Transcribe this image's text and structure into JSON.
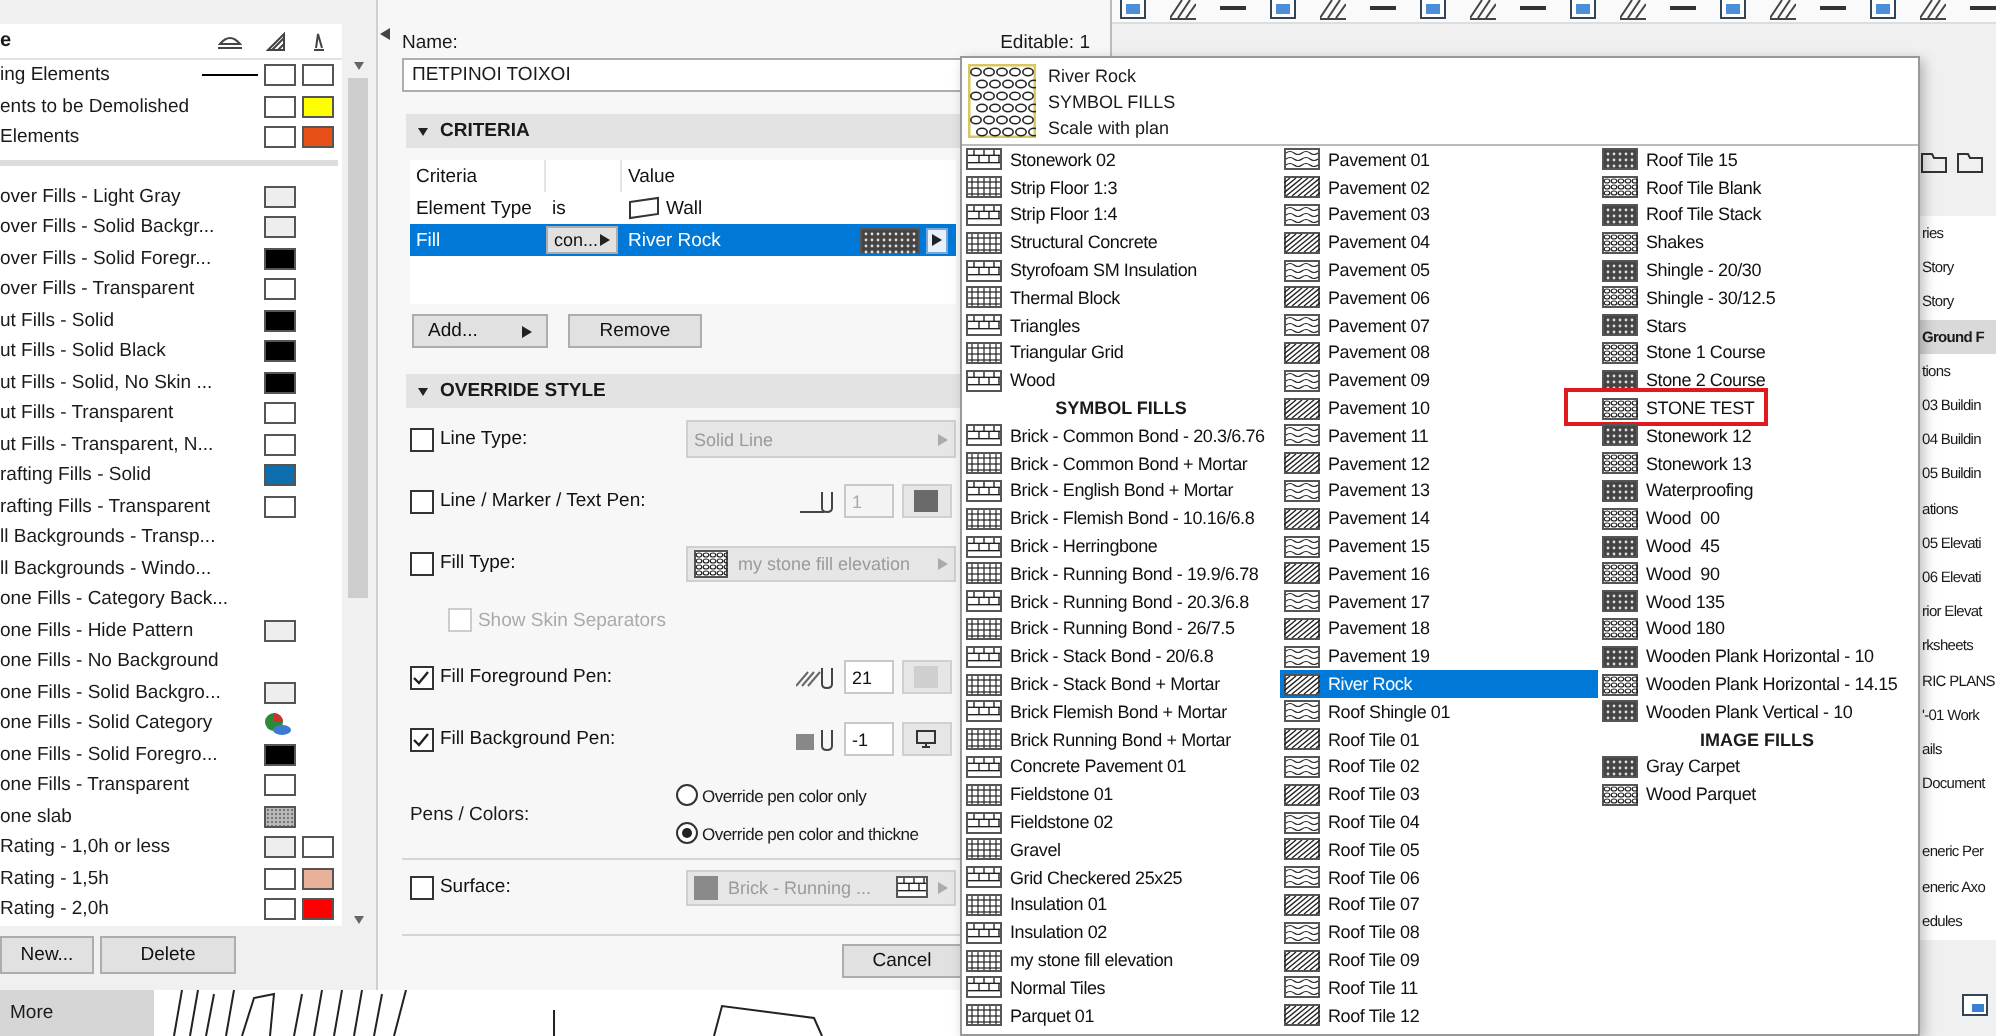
{
  "left_panel": {
    "heading": "e",
    "top_rows": [
      {
        "label": "ing Elements",
        "swatches": [
          {
            "kind": "line"
          },
          {
            "kind": "color",
            "color": "#ffffff"
          },
          {
            "kind": "color",
            "color": "#ffffff"
          }
        ]
      },
      {
        "label": "ents to be Demolished",
        "swatches": [
          {
            "kind": "color",
            "color": "#ffffff"
          },
          {
            "kind": "color",
            "color": "#ffff00"
          }
        ]
      },
      {
        "label": "Elements",
        "swatches": [
          {
            "kind": "color",
            "color": "#ffffff"
          },
          {
            "kind": "color",
            "color": "#e8501a"
          }
        ]
      }
    ],
    "rows": [
      {
        "label": "over Fills - Light Gray",
        "swatches": [
          {
            "kind": "color",
            "color": "#eeeeee"
          }
        ]
      },
      {
        "label": "over Fills - Solid Backgr...",
        "swatches": [
          {
            "kind": "color",
            "color": "#eeeeee"
          }
        ]
      },
      {
        "label": "over Fills - Solid Foregr...",
        "swatches": [
          {
            "kind": "color",
            "color": "#000000"
          }
        ]
      },
      {
        "label": "over Fills - Transparent",
        "swatches": [
          {
            "kind": "color",
            "color": "#ffffff"
          }
        ]
      },
      {
        "label": "ut Fills - Solid",
        "swatches": [
          {
            "kind": "color",
            "color": "#000000"
          }
        ]
      },
      {
        "label": "ut Fills - Solid Black",
        "swatches": [
          {
            "kind": "color",
            "color": "#000000"
          }
        ]
      },
      {
        "label": "ut Fills - Solid, No Skin ...",
        "swatches": [
          {
            "kind": "color",
            "color": "#000000"
          }
        ]
      },
      {
        "label": "ut Fills - Transparent",
        "swatches": [
          {
            "kind": "color",
            "color": "#ffffff"
          }
        ]
      },
      {
        "label": "ut Fills - Transparent, N...",
        "swatches": [
          {
            "kind": "color",
            "color": "#ffffff"
          }
        ]
      },
      {
        "label": "rafting Fills - Solid",
        "swatches": [
          {
            "kind": "color",
            "color": "#0d6fae"
          }
        ]
      },
      {
        "label": "rafting Fills - Transparent",
        "swatches": [
          {
            "kind": "color",
            "color": "#ffffff"
          }
        ]
      },
      {
        "label": "ll Backgrounds - Transp..."
      },
      {
        "label": "ll Backgrounds - Windo..."
      },
      {
        "label": "one Fills - Category Back..."
      },
      {
        "label": "one Fills - Hide Pattern",
        "swatches": [
          {
            "kind": "color",
            "color": "#eeeeee"
          }
        ]
      },
      {
        "label": "one Fills - No Background"
      },
      {
        "label": "one Fills - Solid Backgro...",
        "swatches": [
          {
            "kind": "color",
            "color": "#eeeeee"
          }
        ]
      },
      {
        "label": "one Fills - Solid Category",
        "swatches": [
          {
            "kind": "category"
          }
        ]
      },
      {
        "label": "one Fills - Solid Foregro...",
        "swatches": [
          {
            "kind": "color",
            "color": "#000000"
          }
        ]
      },
      {
        "label": "one Fills - Transparent",
        "swatches": [
          {
            "kind": "color",
            "color": "#ffffff"
          }
        ]
      },
      {
        "label": "one slab",
        "swatches": [
          {
            "kind": "pattern"
          }
        ]
      },
      {
        "label": "Rating - 1,0h or less",
        "swatches": [
          {
            "kind": "color",
            "color": "#eeeeee"
          },
          {
            "kind": "color",
            "color": "#ffffff"
          }
        ]
      },
      {
        "label": "Rating - 1,5h",
        "swatches": [
          {
            "kind": "color",
            "color": "#ffffff"
          },
          {
            "kind": "color",
            "color": "#e9b09a"
          }
        ]
      },
      {
        "label": "Rating - 2,0h",
        "swatches": [
          {
            "kind": "color",
            "color": "#ffffff"
          },
          {
            "kind": "color",
            "color": "#ff0000"
          }
        ]
      }
    ],
    "buttons": [
      "New...",
      "Delete"
    ],
    "more_tab": "More"
  },
  "rule_dialog": {
    "name_label": "Name:",
    "name_value": "ΠΕΤΡΙΝΟΙ ΤΟΙΧΟΙ",
    "editable": "Editable: 1",
    "criteria": {
      "title": "CRITERIA",
      "expanded": true,
      "criteria_heading": "Criteria",
      "value_heading": "Value",
      "rows": [
        {
          "kind": "element-type",
          "criteria": "Element Type",
          "operator": "is",
          "value": "Wall",
          "selected": false
        },
        {
          "kind": "fill",
          "criteria": "Fill",
          "operator": "con...",
          "value": "River Rock",
          "selected": true
        }
      ],
      "add_button": "Add...",
      "remove_button": "Remove"
    },
    "override": {
      "title": "OVERRIDE STYLE",
      "expanded": true,
      "options": [
        {
          "kind": "dropdown",
          "label": "Line Type:",
          "checked": false,
          "value": "Solid Line"
        },
        {
          "kind": "line-pen",
          "label": "Line / Marker / Text Pen:",
          "checked": false,
          "value": "1"
        },
        {
          "kind": "fill-dropdown",
          "label": "Fill Type:",
          "checked": false,
          "value": "my stone fill elevation"
        },
        {
          "kind": "sub-check",
          "label": "Show Skin Separators",
          "checked": false,
          "disabled": true
        },
        {
          "kind": "fg-pen",
          "label": "Fill Foreground Pen:",
          "checked": true,
          "value": "21"
        },
        {
          "kind": "bg-pen",
          "label": "Fill Background Pen:",
          "checked": true,
          "value": "-1"
        }
      ],
      "pens_colors": {
        "label": "Pens / Colors:",
        "choices": [
          {
            "label": "Override pen color only",
            "selected": false
          },
          {
            "label": "Override pen color and thickne",
            "selected": true
          }
        ]
      },
      "surface": {
        "label": "Surface:",
        "checked": false,
        "value": "Brick - Running ..."
      }
    },
    "cancel": "Cancel"
  },
  "fill_list": {
    "preview": {
      "name": "River Rock",
      "group": "SYMBOL FILLS",
      "scale": "Scale with plan"
    },
    "columns": [
      {
        "items": [
          {
            "kind": "fill",
            "label": "Stonework 02",
            "selected": false,
            "annotated": false
          },
          {
            "kind": "fill",
            "label": "Strip Floor 1:3",
            "selected": false,
            "annotated": false
          },
          {
            "kind": "fill",
            "label": "Strip Floor 1:4",
            "selected": false,
            "annotated": false
          },
          {
            "kind": "fill",
            "label": "Structural Concrete",
            "selected": false,
            "annotated": false
          },
          {
            "kind": "fill",
            "label": "Styrofoam SM Insulation",
            "selected": false,
            "annotated": false
          },
          {
            "kind": "fill",
            "label": "Thermal Block",
            "selected": false,
            "annotated": false
          },
          {
            "kind": "fill",
            "label": "Triangles",
            "selected": false,
            "annotated": false
          },
          {
            "kind": "fill",
            "label": "Triangular Grid",
            "selected": false,
            "annotated": false
          },
          {
            "kind": "fill",
            "label": "Wood",
            "selected": false,
            "annotated": false
          },
          {
            "kind": "group",
            "label": "SYMBOL FILLS"
          },
          {
            "kind": "fill",
            "label": "Brick - Common Bond - 20.3/6.76",
            "selected": false,
            "annotated": false
          },
          {
            "kind": "fill",
            "label": "Brick - Common Bond + Mortar",
            "selected": false,
            "annotated": false
          },
          {
            "kind": "fill",
            "label": "Brick - English Bond + Mortar",
            "selected": false,
            "annotated": false
          },
          {
            "kind": "fill",
            "label": "Brick - Flemish Bond - 10.16/6.8",
            "selected": false,
            "annotated": false
          },
          {
            "kind": "fill",
            "label": "Brick - Herringbone",
            "selected": false,
            "annotated": false
          },
          {
            "kind": "fill",
            "label": "Brick - Running Bond - 19.9/6.78",
            "selected": false,
            "annotated": false
          },
          {
            "kind": "fill",
            "label": "Brick - Running Bond - 20.3/6.8",
            "selected": false,
            "annotated": false
          },
          {
            "kind": "fill",
            "label": "Brick - Running Bond - 26/7.5",
            "selected": false,
            "annotated": false
          },
          {
            "kind": "fill",
            "label": "Brick - Stack Bond - 20/6.8",
            "selected": false,
            "annotated": false
          },
          {
            "kind": "fill",
            "label": "Brick - Stack Bond + Mortar",
            "selected": false,
            "annotated": false
          },
          {
            "kind": "fill",
            "label": "Brick Flemish Bond + Mortar",
            "selected": false,
            "annotated": false
          },
          {
            "kind": "fill",
            "label": "Brick Running Bond + Mortar",
            "selected": false,
            "annotated": false
          },
          {
            "kind": "fill",
            "label": "Concrete Pavement 01",
            "selected": false,
            "annotated": false
          },
          {
            "kind": "fill",
            "label": "Fieldstone 01",
            "selected": false,
            "annotated": false
          },
          {
            "kind": "fill",
            "label": "Fieldstone 02",
            "selected": false,
            "annotated": false
          },
          {
            "kind": "fill",
            "label": "Gravel",
            "selected": false,
            "annotated": false
          },
          {
            "kind": "fill",
            "label": "Grid Checkered 25x25",
            "selected": false,
            "annotated": false
          },
          {
            "kind": "fill",
            "label": "Insulation 01",
            "selected": false,
            "annotated": false
          },
          {
            "kind": "fill",
            "label": "Insulation 02",
            "selected": false,
            "annotated": false
          },
          {
            "kind": "fill",
            "label": "my stone fill elevation",
            "selected": false,
            "annotated": false
          },
          {
            "kind": "fill",
            "label": "Normal Tiles",
            "selected": false,
            "annotated": false
          },
          {
            "kind": "fill",
            "label": "Parquet 01",
            "selected": false,
            "annotated": false
          }
        ]
      },
      {
        "items": [
          {
            "kind": "fill",
            "label": "Pavement 01",
            "selected": false,
            "annotated": false
          },
          {
            "kind": "fill",
            "label": "Pavement 02",
            "selected": false,
            "annotated": false
          },
          {
            "kind": "fill",
            "label": "Pavement 03",
            "selected": false,
            "annotated": false
          },
          {
            "kind": "fill",
            "label": "Pavement 04",
            "selected": false,
            "annotated": false
          },
          {
            "kind": "fill",
            "label": "Pavement 05",
            "selected": false,
            "annotated": false
          },
          {
            "kind": "fill",
            "label": "Pavement 06",
            "selected": false,
            "annotated": false
          },
          {
            "kind": "fill",
            "label": "Pavement 07",
            "selected": false,
            "annotated": false
          },
          {
            "kind": "fill",
            "label": "Pavement 08",
            "selected": false,
            "annotated": false
          },
          {
            "kind": "fill",
            "label": "Pavement 09",
            "selected": false,
            "annotated": false
          },
          {
            "kind": "fill",
            "label": "Pavement 10",
            "selected": false,
            "annotated": false
          },
          {
            "kind": "fill",
            "label": "Pavement 11",
            "selected": false,
            "annotated": false
          },
          {
            "kind": "fill",
            "label": "Pavement 12",
            "selected": false,
            "annotated": false
          },
          {
            "kind": "fill",
            "label": "Pavement 13",
            "selected": false,
            "annotated": false
          },
          {
            "kind": "fill",
            "label": "Pavement 14",
            "selected": false,
            "annotated": false
          },
          {
            "kind": "fill",
            "label": "Pavement 15",
            "selected": false,
            "annotated": false
          },
          {
            "kind": "fill",
            "label": "Pavement 16",
            "selected": false,
            "annotated": false
          },
          {
            "kind": "fill",
            "label": "Pavement 17",
            "selected": false,
            "annotated": false
          },
          {
            "kind": "fill",
            "label": "Pavement 18",
            "selected": false,
            "annotated": false
          },
          {
            "kind": "fill",
            "label": "Pavement 19",
            "selected": false,
            "annotated": false
          },
          {
            "kind": "fill",
            "label": "River Rock",
            "selected": true,
            "annotated": false
          },
          {
            "kind": "fill",
            "label": "Roof Shingle 01",
            "selected": false,
            "annotated": false
          },
          {
            "kind": "fill",
            "label": "Roof Tile 01",
            "selected": false,
            "annotated": false
          },
          {
            "kind": "fill",
            "label": "Roof Tile 02",
            "selected": false,
            "annotated": false
          },
          {
            "kind": "fill",
            "label": "Roof Tile 03",
            "selected": false,
            "annotated": false
          },
          {
            "kind": "fill",
            "label": "Roof Tile 04",
            "selected": false,
            "annotated": false
          },
          {
            "kind": "fill",
            "label": "Roof Tile 05",
            "selected": false,
            "annotated": false
          },
          {
            "kind": "fill",
            "label": "Roof Tile 06",
            "selected": false,
            "annotated": false
          },
          {
            "kind": "fill",
            "label": "Roof Tile 07",
            "selected": false,
            "annotated": false
          },
          {
            "kind": "fill",
            "label": "Roof Tile 08",
            "selected": false,
            "annotated": false
          },
          {
            "kind": "fill",
            "label": "Roof Tile 09",
            "selected": false,
            "annotated": false
          },
          {
            "kind": "fill",
            "label": "Roof Tile 11",
            "selected": false,
            "annotated": false
          },
          {
            "kind": "fill",
            "label": "Roof Tile 12",
            "selected": false,
            "annotated": false
          }
        ]
      },
      {
        "items": [
          {
            "kind": "fill",
            "label": "Roof Tile 15",
            "selected": false,
            "annotated": false
          },
          {
            "kind": "fill",
            "label": "Roof Tile Blank",
            "selected": false,
            "annotated": false
          },
          {
            "kind": "fill",
            "label": "Roof Tile Stack",
            "selected": false,
            "annotated": false
          },
          {
            "kind": "fill",
            "label": "Shakes",
            "selected": false,
            "annotated": false
          },
          {
            "kind": "fill",
            "label": "Shingle - 20/30",
            "selected": false,
            "annotated": false
          },
          {
            "kind": "fill",
            "label": "Shingle - 30/12.5",
            "selected": false,
            "annotated": false
          },
          {
            "kind": "fill",
            "label": "Stars",
            "selected": false,
            "annotated": false
          },
          {
            "kind": "fill",
            "label": "Stone 1 Course",
            "selected": false,
            "annotated": false
          },
          {
            "kind": "fill",
            "label": "Stone 2 Course",
            "selected": false,
            "annotated": false
          },
          {
            "kind": "fill",
            "label": "STONE TEST",
            "selected": false,
            "annotated": true
          },
          {
            "kind": "fill",
            "label": "Stonework 12",
            "selected": false,
            "annotated": false
          },
          {
            "kind": "fill",
            "label": "Stonework 13",
            "selected": false,
            "annotated": false
          },
          {
            "kind": "fill",
            "label": "Waterproofing",
            "selected": false,
            "annotated": false
          },
          {
            "kind": "fill",
            "label": "Wood  00",
            "selected": false,
            "annotated": false
          },
          {
            "kind": "fill",
            "label": "Wood  45",
            "selected": false,
            "annotated": false
          },
          {
            "kind": "fill",
            "label": "Wood  90",
            "selected": false,
            "annotated": false
          },
          {
            "kind": "fill",
            "label": "Wood 135",
            "selected": false,
            "annotated": false
          },
          {
            "kind": "fill",
            "label": "Wood 180",
            "selected": false,
            "annotated": false
          },
          {
            "kind": "fill",
            "label": "Wooden Plank Horizontal - 10",
            "selected": false,
            "annotated": false
          },
          {
            "kind": "fill",
            "label": "Wooden Plank Horizontal - 14.15",
            "selected": false,
            "annotated": false
          },
          {
            "kind": "fill",
            "label": "Wooden Plank Vertical - 10",
            "selected": false,
            "annotated": false
          },
          {
            "kind": "group",
            "label": "IMAGE FILLS"
          },
          {
            "kind": "fill",
            "label": "Gray Carpet",
            "selected": false,
            "annotated": false
          },
          {
            "kind": "fill",
            "label": "Wood Parquet",
            "selected": false,
            "annotated": false
          }
        ]
      }
    ]
  },
  "navigator": {
    "groups": [
      {
        "items": [
          {
            "label": "ries",
            "selected": false
          },
          {
            "label": "Story",
            "selected": false
          },
          {
            "label": "Story",
            "selected": false
          },
          {
            "label": "Ground F",
            "selected": true
          },
          {
            "label": "tions",
            "selected": false
          },
          {
            "label": "03 Buildin",
            "selected": false
          },
          {
            "label": "04 Buildin",
            "selected": false
          },
          {
            "label": "05 Buildin",
            "selected": false
          },
          {
            "label": "ations",
            "selected": false
          },
          {
            "label": "05 Elevati",
            "selected": false
          },
          {
            "label": "06 Elevati",
            "selected": false
          },
          {
            "label": "rior Elevat",
            "selected": false
          },
          {
            "label": "rksheets",
            "selected": false
          },
          {
            "label": "RIC PLANS",
            "selected": false
          },
          {
            "label": "'-01 Work",
            "selected": false
          },
          {
            "label": "ails",
            "selected": false
          },
          {
            "label": "Document",
            "selected": false
          }
        ]
      },
      {
        "items": [
          {
            "label": "eneric Per",
            "selected": false
          },
          {
            "label": "eneric Axo",
            "selected": false
          },
          {
            "label": "edules",
            "selected": false
          }
        ]
      }
    ]
  }
}
